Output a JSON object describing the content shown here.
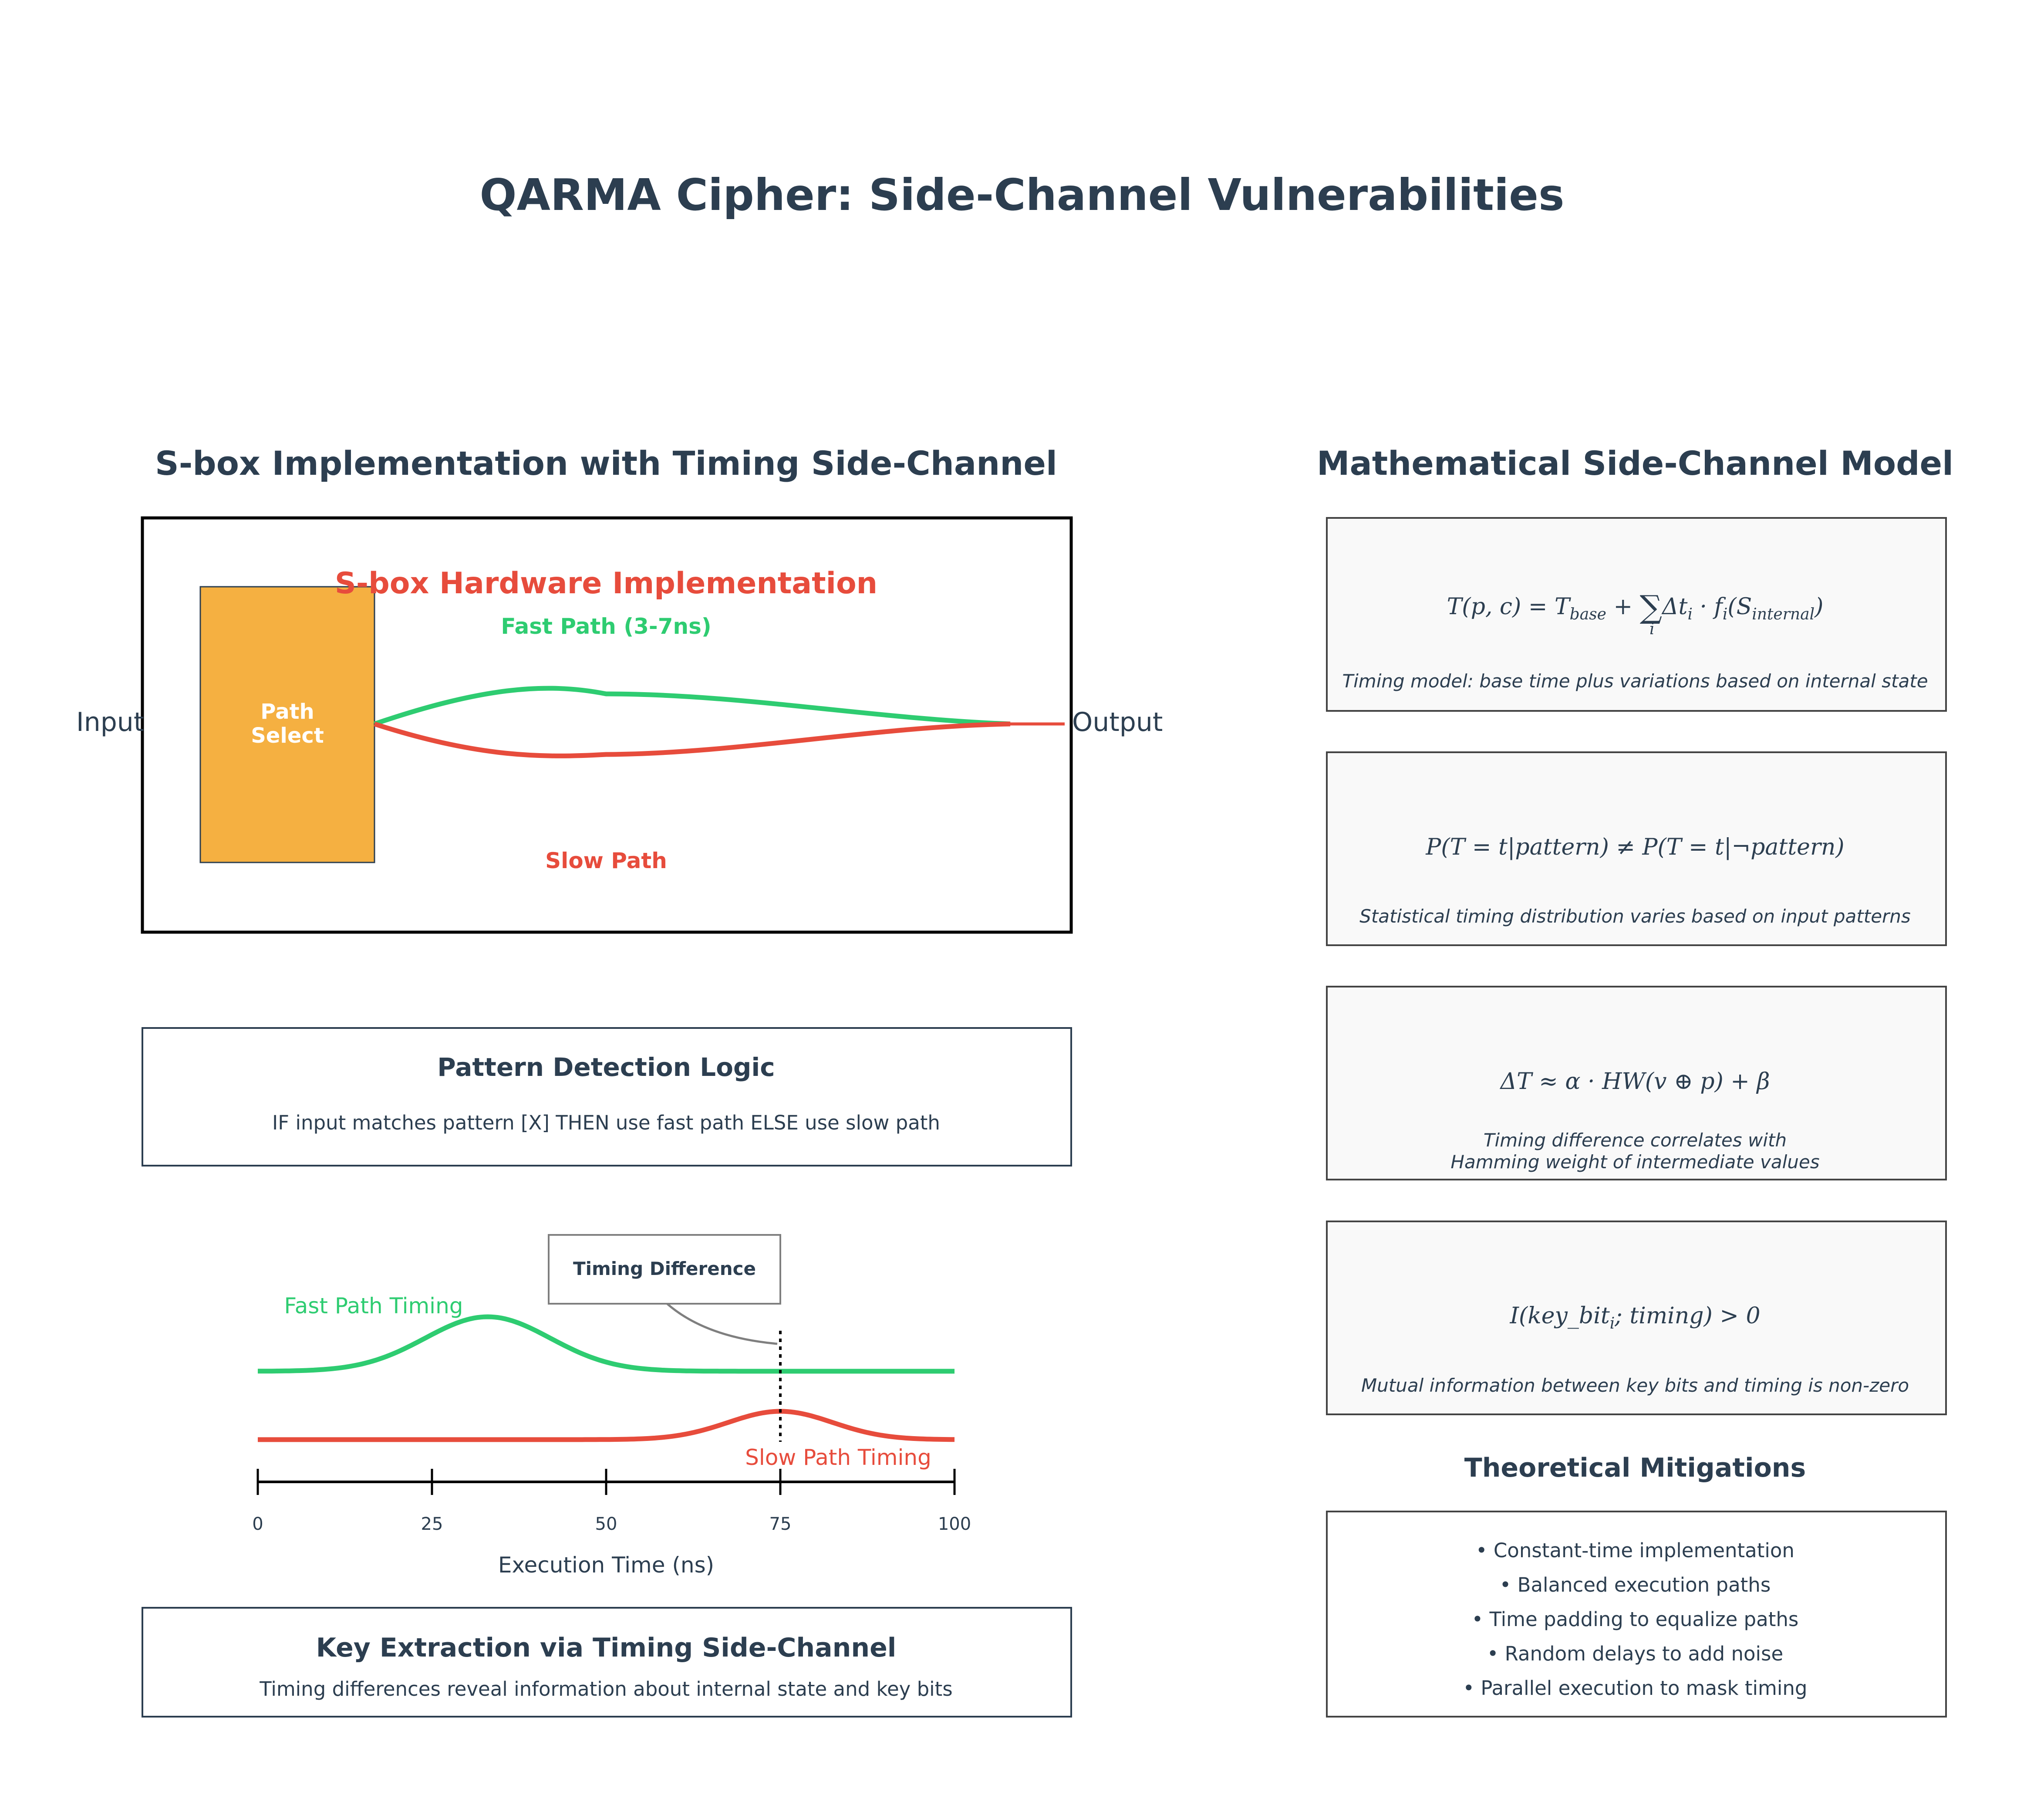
{
  "title": "QARMA Cipher: Side-Channel Vulnerabilities",
  "colors": {
    "text": "#2c3e50",
    "fast": "#2ecc71",
    "slow": "#e74c3c",
    "select": "#f5b041",
    "formula_bg": "#f9f9f9"
  },
  "left": {
    "section_title": "S-box Implementation with Timing Side-Channel",
    "sbox": {
      "title": "S-box Hardware Implementation",
      "fast_label": "Fast Path (3-7ns)",
      "slow_label": "Slow Path",
      "select_line1": "Path",
      "select_line2": "Select",
      "input_label": "Input",
      "output_label": "Output"
    },
    "pattern": {
      "title": "Pattern Detection Logic",
      "text": "IF input matches pattern [X] THEN use fast path ELSE use slow path"
    },
    "timing_chart": {
      "fast_label": "Fast Path Timing",
      "slow_label": "Slow Path Timing",
      "callout": "Timing Difference",
      "xlabel": "Execution Time (ns)",
      "ticks": [
        "0",
        "25",
        "50",
        "75",
        "100"
      ]
    },
    "key_box": {
      "title": "Key Extraction via Timing Side-Channel",
      "text": "Timing differences reveal information about internal state and key bits"
    }
  },
  "right": {
    "section_title": "Mathematical Side-Channel Model",
    "formulas": [
      {
        "caption": "Timing model: base time plus variations based on internal state"
      },
      {
        "formula": "P(T = t|pattern) ≠ P(T = t|¬pattern)",
        "caption": "Statistical timing distribution varies based on input patterns"
      },
      {
        "formula": "ΔT ≈ α · HW(v ⊕ p) + β",
        "caption_line1": "Timing difference correlates with",
        "caption_line2": "Hamming weight of intermediate values"
      },
      {
        "caption": "Mutual information between key bits and timing is non-zero"
      }
    ],
    "mitigations": {
      "title": "Theoretical Mitigations",
      "items": [
        "• Constant-time implementation",
        "• Balanced execution paths",
        "• Time padding to equalize paths",
        "• Random delays to add noise",
        "• Parallel execution to mask timing"
      ]
    }
  }
}
